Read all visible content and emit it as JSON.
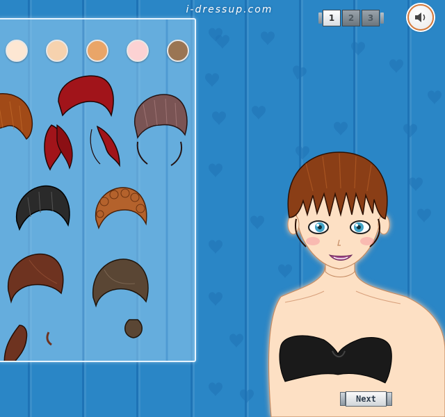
{
  "header": {
    "site_title": "i-dressup.com"
  },
  "pager": {
    "pages": [
      "1",
      "2",
      "3"
    ],
    "active_page": "1"
  },
  "sound": {
    "icon": "speaker-icon"
  },
  "skin_tones": [
    {
      "name": "porcelain",
      "color": "#fde7d3"
    },
    {
      "name": "light",
      "color": "#f6d2ae"
    },
    {
      "name": "tan",
      "color": "#e9a568"
    },
    {
      "name": "pink",
      "color": "#fcd2d3"
    },
    {
      "name": "brown",
      "color": "#9a7553"
    }
  ],
  "hair_options": [
    {
      "name": "auburn-bob",
      "color": "#a14a17"
    },
    {
      "name": "red-pigtails",
      "color": "#a1141a"
    },
    {
      "name": "mauve-bob",
      "color": "#7a5454"
    },
    {
      "name": "black-short",
      "color": "#2a2a2a"
    },
    {
      "name": "copper-curly",
      "color": "#b4622c"
    },
    {
      "name": "chestnut-side-ponytail",
      "color": "#6e3320"
    },
    {
      "name": "ash-brown-bun",
      "color": "#5a4634"
    }
  ],
  "model": {
    "hair_color": "#8a3e16",
    "top_color": "#1a1a1a",
    "skin_color": "#fde0c4",
    "eye_color": "#43a4c6"
  },
  "next_button": {
    "label": "Next"
  }
}
